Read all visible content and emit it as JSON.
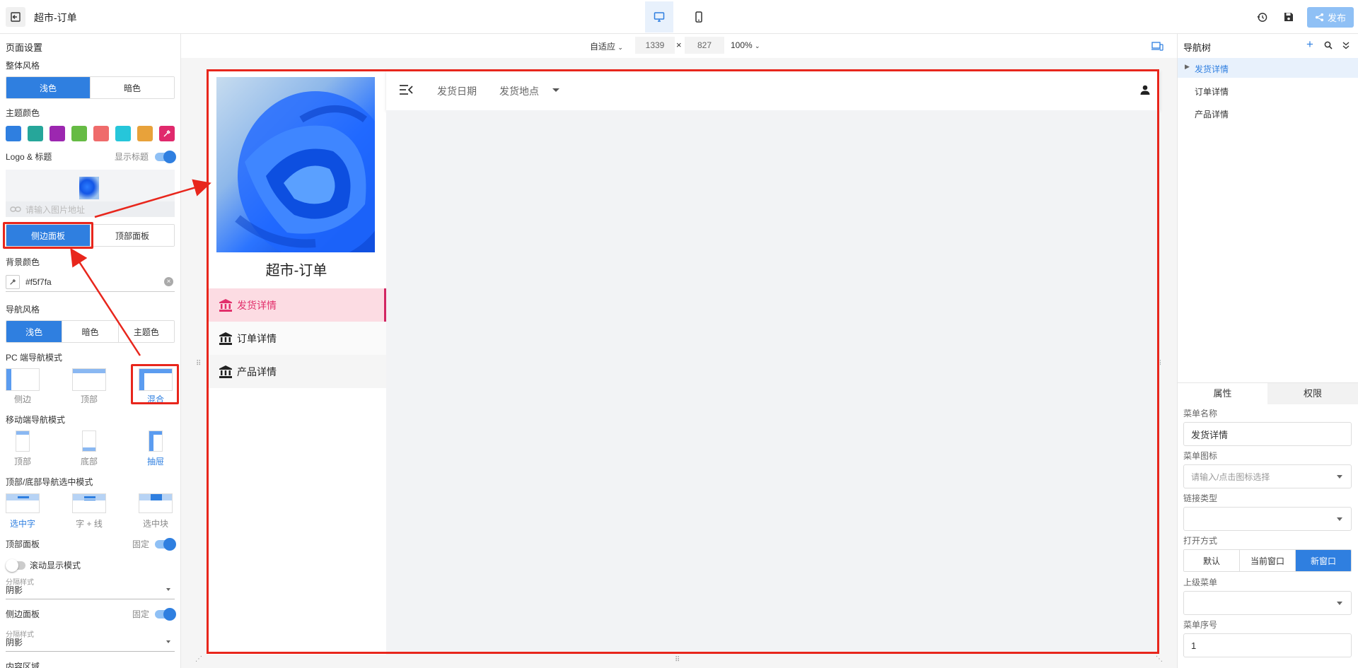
{
  "header": {
    "title": "超市-订单",
    "publish_label": "发布"
  },
  "canvas_toolbar": {
    "fit_label": "自适应",
    "width": "1339",
    "times": "×",
    "height": "827",
    "zoom": "100%"
  },
  "left_panel": {
    "page_settings": "页面设置",
    "overall_style": "整体风格",
    "style_options": [
      "浅色",
      "暗色"
    ],
    "theme_color_label": "主题颜色",
    "theme_colors": [
      "#2f7fe0",
      "#26a69a",
      "#9c27b0",
      "#66bb44",
      "#ef6b6b",
      "#26c6da",
      "#e8a23a",
      "#e0296c"
    ],
    "logo_title_label": "Logo & 标题",
    "show_title_label": "显示标题",
    "image_url_placeholder": "请输入图片地址",
    "panel_options": [
      "侧边面板",
      "顶部面板"
    ],
    "bg_color_label": "背景颜色",
    "bg_color_value": "#f5f7fa",
    "nav_style_label": "导航风格",
    "nav_style_options": [
      "浅色",
      "暗色",
      "主题色"
    ],
    "pc_nav_mode_label": "PC 端导航模式",
    "pc_nav_modes": [
      "侧边",
      "顶部",
      "混合"
    ],
    "mobile_nav_mode_label": "移动端导航模式",
    "mobile_nav_modes": [
      "顶部",
      "底部",
      "抽屉"
    ],
    "nav_select_mode_label": "顶部/底部导航选中模式",
    "nav_select_modes": [
      "选中字",
      "字 + 线",
      "选中块"
    ],
    "top_panel_label": "顶部面板",
    "fixed_label": "固定",
    "scroll_display_label": "滚动显示模式",
    "divider_style_label": "分隔样式",
    "divider_style_value": "阴影",
    "side_panel_label": "侧边面板",
    "fixed_label2": "固定",
    "divider_style_label2": "分隔样式",
    "divider_style_value2": "阴影",
    "content_area_label": "内容区域"
  },
  "preview": {
    "app_title": "超市-订单",
    "top_nav": [
      "发货日期",
      "发货地点"
    ],
    "side_menu": [
      "发货详情",
      "订单详情",
      "产品详情"
    ]
  },
  "right_panel": {
    "nav_tree_label": "导航树",
    "tree_items": [
      "发货详情",
      "订单详情",
      "产品详情"
    ],
    "tabs": [
      "属性",
      "权限"
    ],
    "menu_name_label": "菜单名称",
    "menu_name_value": "发货详情",
    "menu_icon_label": "菜单图标",
    "menu_icon_placeholder": "请输入/点击图标选择",
    "link_type_label": "链接类型",
    "open_mode_label": "打开方式",
    "open_modes": [
      "默认",
      "当前窗口",
      "新窗口"
    ],
    "parent_menu_label": "上级菜单",
    "menu_order_label": "菜单序号",
    "menu_order_value": "1"
  },
  "colors": {
    "accent": "#2f7fe0",
    "annotation": "#e8261c",
    "active_menu": "#e2306c"
  }
}
